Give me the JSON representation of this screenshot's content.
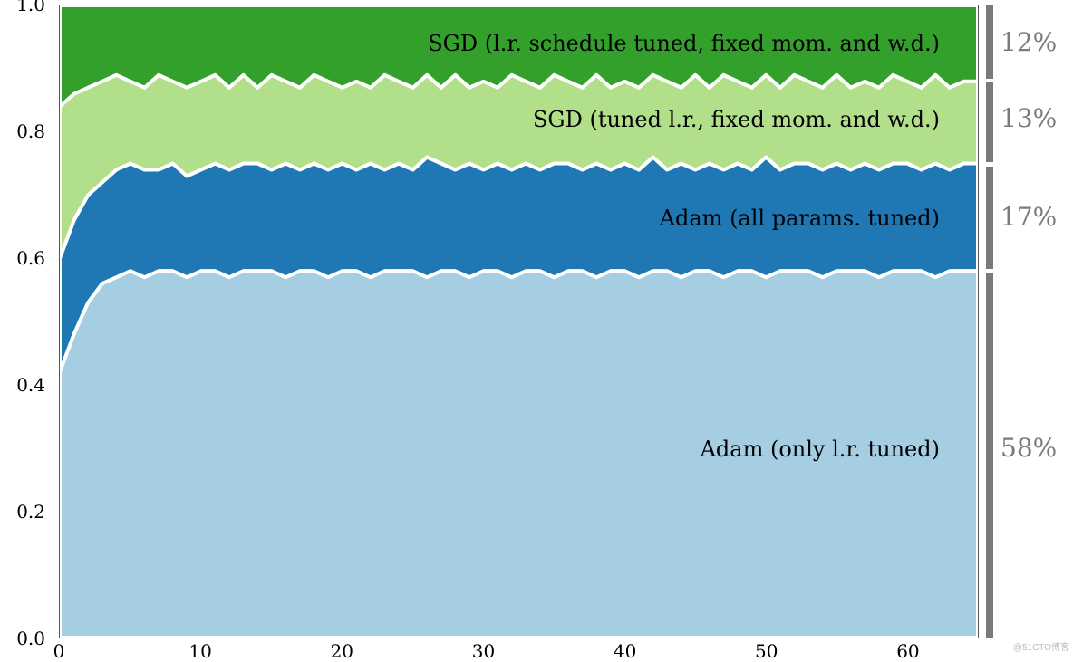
{
  "chart_data": {
    "type": "area",
    "x": [
      0,
      1,
      2,
      3,
      4,
      5,
      6,
      7,
      8,
      9,
      10,
      11,
      12,
      13,
      14,
      15,
      16,
      17,
      18,
      19,
      20,
      21,
      22,
      23,
      24,
      25,
      26,
      27,
      28,
      29,
      30,
      31,
      32,
      33,
      34,
      35,
      36,
      37,
      38,
      39,
      40,
      41,
      42,
      43,
      44,
      45,
      46,
      47,
      48,
      49,
      50,
      51,
      52,
      53,
      54,
      55,
      56,
      57,
      58,
      59,
      60,
      61,
      62,
      63,
      64,
      65
    ],
    "xlim": [
      0,
      65
    ],
    "ylim": [
      0,
      1.0
    ],
    "xlabel": "",
    "ylabel": "",
    "title": "",
    "x_ticks": [
      0,
      10,
      20,
      30,
      40,
      50,
      60
    ],
    "y_ticks": [
      0.0,
      0.2,
      0.4,
      0.6,
      0.8,
      1.0
    ],
    "series": [
      {
        "name": "Adam (only l.r. tuned)",
        "label": "Adam (only l.r. tuned)",
        "final_pct": "58%",
        "color": "#a6cee3",
        "values": [
          0.42,
          0.48,
          0.53,
          0.56,
          0.57,
          0.58,
          0.57,
          0.58,
          0.58,
          0.57,
          0.58,
          0.58,
          0.57,
          0.58,
          0.58,
          0.58,
          0.57,
          0.58,
          0.58,
          0.57,
          0.58,
          0.58,
          0.57,
          0.58,
          0.58,
          0.58,
          0.57,
          0.58,
          0.58,
          0.57,
          0.58,
          0.58,
          0.57,
          0.58,
          0.58,
          0.57,
          0.58,
          0.58,
          0.57,
          0.58,
          0.58,
          0.57,
          0.58,
          0.58,
          0.57,
          0.58,
          0.58,
          0.57,
          0.58,
          0.58,
          0.57,
          0.58,
          0.58,
          0.58,
          0.57,
          0.58,
          0.58,
          0.58,
          0.57,
          0.58,
          0.58,
          0.58,
          0.57,
          0.58,
          0.58,
          0.58
        ]
      },
      {
        "name": "Adam (all params. tuned)",
        "label": "Adam (all params. tuned)",
        "final_pct": "17%",
        "color": "#1f78b4",
        "values": [
          0.6,
          0.66,
          0.7,
          0.72,
          0.74,
          0.75,
          0.74,
          0.74,
          0.75,
          0.73,
          0.74,
          0.75,
          0.74,
          0.75,
          0.75,
          0.74,
          0.75,
          0.74,
          0.75,
          0.74,
          0.75,
          0.74,
          0.75,
          0.74,
          0.75,
          0.74,
          0.76,
          0.75,
          0.74,
          0.75,
          0.74,
          0.75,
          0.74,
          0.75,
          0.74,
          0.75,
          0.75,
          0.74,
          0.75,
          0.74,
          0.75,
          0.74,
          0.76,
          0.74,
          0.75,
          0.74,
          0.75,
          0.74,
          0.75,
          0.74,
          0.76,
          0.74,
          0.75,
          0.75,
          0.74,
          0.75,
          0.74,
          0.75,
          0.74,
          0.75,
          0.75,
          0.74,
          0.75,
          0.74,
          0.75,
          0.75
        ]
      },
      {
        "name": "SGD (tuned l.r., fixed mom. and w.d.)",
        "label": "SGD (tuned l.r., fixed mom. and w.d.)",
        "final_pct": "13%",
        "color": "#b2df8a",
        "values": [
          0.84,
          0.86,
          0.87,
          0.88,
          0.89,
          0.88,
          0.87,
          0.89,
          0.88,
          0.87,
          0.88,
          0.89,
          0.87,
          0.89,
          0.87,
          0.89,
          0.88,
          0.87,
          0.89,
          0.88,
          0.87,
          0.88,
          0.87,
          0.89,
          0.88,
          0.87,
          0.89,
          0.87,
          0.89,
          0.87,
          0.88,
          0.87,
          0.89,
          0.88,
          0.87,
          0.89,
          0.88,
          0.87,
          0.89,
          0.87,
          0.88,
          0.87,
          0.89,
          0.88,
          0.87,
          0.89,
          0.87,
          0.89,
          0.88,
          0.87,
          0.89,
          0.87,
          0.89,
          0.88,
          0.87,
          0.89,
          0.87,
          0.88,
          0.87,
          0.89,
          0.88,
          0.87,
          0.89,
          0.87,
          0.88,
          0.88
        ]
      },
      {
        "name": "SGD (l.r. schedule tuned, fixed mom. and w.d.)",
        "label": "SGD (l.r. schedule tuned, fixed mom. and w.d.)",
        "final_pct": "12%",
        "color": "#33a02c",
        "values": [
          1.0,
          1.0,
          1.0,
          1.0,
          1.0,
          1.0,
          1.0,
          1.0,
          1.0,
          1.0,
          1.0,
          1.0,
          1.0,
          1.0,
          1.0,
          1.0,
          1.0,
          1.0,
          1.0,
          1.0,
          1.0,
          1.0,
          1.0,
          1.0,
          1.0,
          1.0,
          1.0,
          1.0,
          1.0,
          1.0,
          1.0,
          1.0,
          1.0,
          1.0,
          1.0,
          1.0,
          1.0,
          1.0,
          1.0,
          1.0,
          1.0,
          1.0,
          1.0,
          1.0,
          1.0,
          1.0,
          1.0,
          1.0,
          1.0,
          1.0,
          1.0,
          1.0,
          1.0,
          1.0,
          1.0,
          1.0,
          1.0,
          1.0,
          1.0,
          1.0,
          1.0,
          1.0,
          1.0,
          1.0,
          1.0,
          1.0
        ]
      }
    ],
    "label_positions_y": {
      "s0": 0.3,
      "s1": 0.665,
      "s2": 0.82,
      "s3": 0.94
    },
    "rlabel_positions_y": {
      "s0": 0.3,
      "s1": 0.665,
      "s2": 0.82,
      "s3": 0.94
    },
    "right_bars": [
      {
        "y0": 0.0,
        "y1": 0.577
      },
      {
        "y0": 0.583,
        "y1": 0.745
      },
      {
        "y0": 0.751,
        "y1": 0.877
      },
      {
        "y0": 0.883,
        "y1": 1.0
      }
    ]
  },
  "watermark": "@51CTO博客"
}
